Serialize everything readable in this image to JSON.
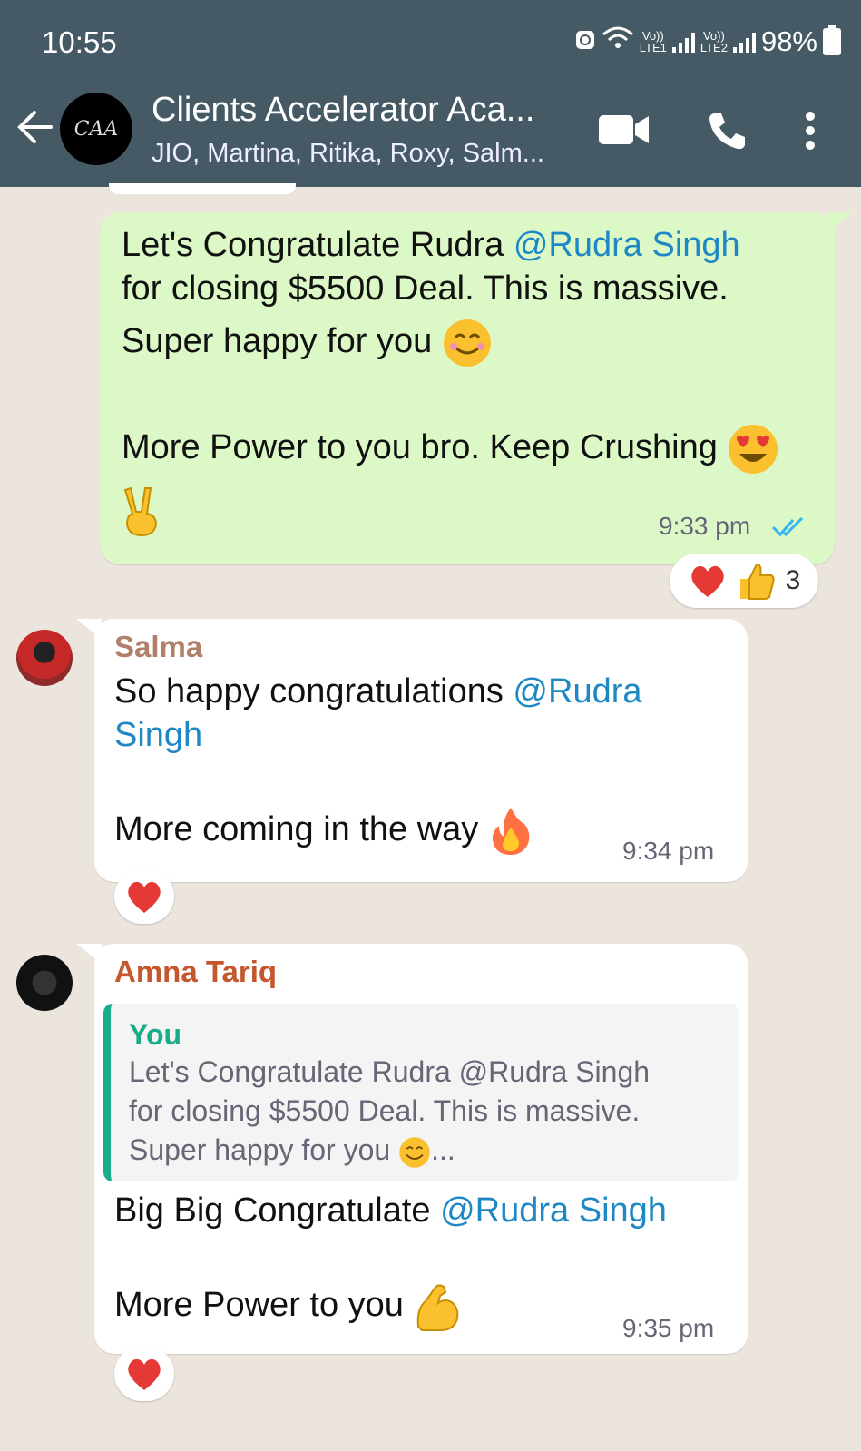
{
  "status_bar": {
    "time": "10:55",
    "sim1_label": "Vo))",
    "sim1_sub": "LTE1",
    "sim2_label": "Vo))",
    "sim2_sub": "LTE2",
    "battery": "98%"
  },
  "header": {
    "avatar_text": "CAA",
    "title": "Clients Accelerator Aca...",
    "members": "JIO, Martina, Ritika, Roxy, Salm..."
  },
  "messages": [
    {
      "type": "outgoing",
      "lines": [
        "Let's Congratulate Rudra ",
        "@Rudra Singh",
        "for closing $5500 Deal. This is massive.",
        "Super happy for you",
        "More Power to you bro. Keep Crushing"
      ],
      "time": "9:33 pm",
      "reaction_count": "3"
    },
    {
      "type": "incoming",
      "sender": "Salma",
      "lines": [
        "So happy congratulations ",
        "@Rudra",
        "Singh",
        "More coming in the way"
      ],
      "time": "9:34 pm"
    },
    {
      "type": "incoming",
      "sender": "Amna Tariq",
      "quote": {
        "author": "You",
        "lines": [
          "Let's Congratulate Rudra @Rudra Singh",
          "for closing $5500 Deal. This is massive.",
          "Super happy for you",
          "..."
        ]
      },
      "lines": [
        "Big Big Congratulate ",
        "@Rudra Singh",
        "More Power to you"
      ],
      "time": "9:35 pm"
    }
  ],
  "colors": {
    "header_bg": "#455a64",
    "outgoing_bubble": "#dcf8c6",
    "incoming_bubble": "#ffffff",
    "mention": "#1e88c5",
    "salma_name": "#b0806a",
    "amna_name": "#c4572d",
    "quote_author": "#1aab8a",
    "chat_bg": "#ece5dd"
  }
}
